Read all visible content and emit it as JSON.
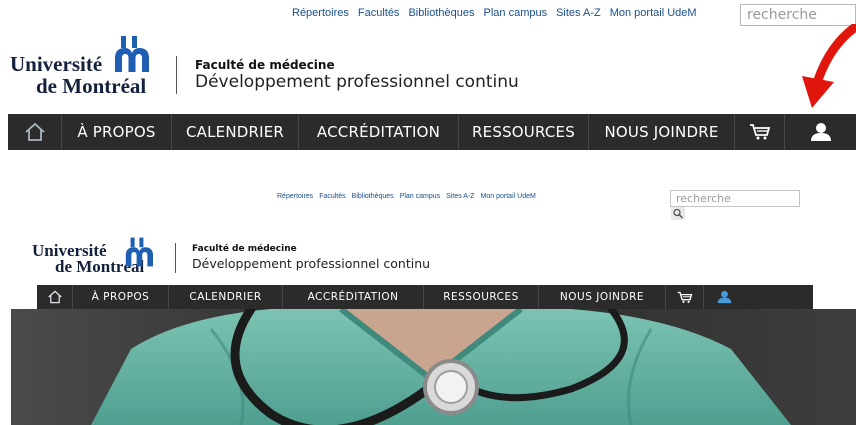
{
  "utility_links": [
    "Répertoires",
    "Facultés",
    "Bibliothèques",
    "Plan campus",
    "Sites A-Z",
    "Mon portail UdeM"
  ],
  "search": {
    "placeholder": "recherche"
  },
  "brand": {
    "university_line1": "Université",
    "university_line2": "de Montréal",
    "faculty": "Faculté de médecine",
    "department": "Développement professionnel continu"
  },
  "nav": {
    "home_icon": "home-icon",
    "items": [
      "À PROPOS",
      "CALENDRIER",
      "ACCRÉDITATION",
      "RESSOURCES",
      "NOUS JOINDRE"
    ],
    "cart_icon": "cart-icon",
    "account_icon": "user-icon"
  },
  "colors": {
    "nav_background": "#2b2b2b",
    "link_blue": "#1a4f8a",
    "logo_blue": "#1e5fb4",
    "arrow_red": "#e0150c",
    "scrub_green": "#5fb0a0"
  }
}
